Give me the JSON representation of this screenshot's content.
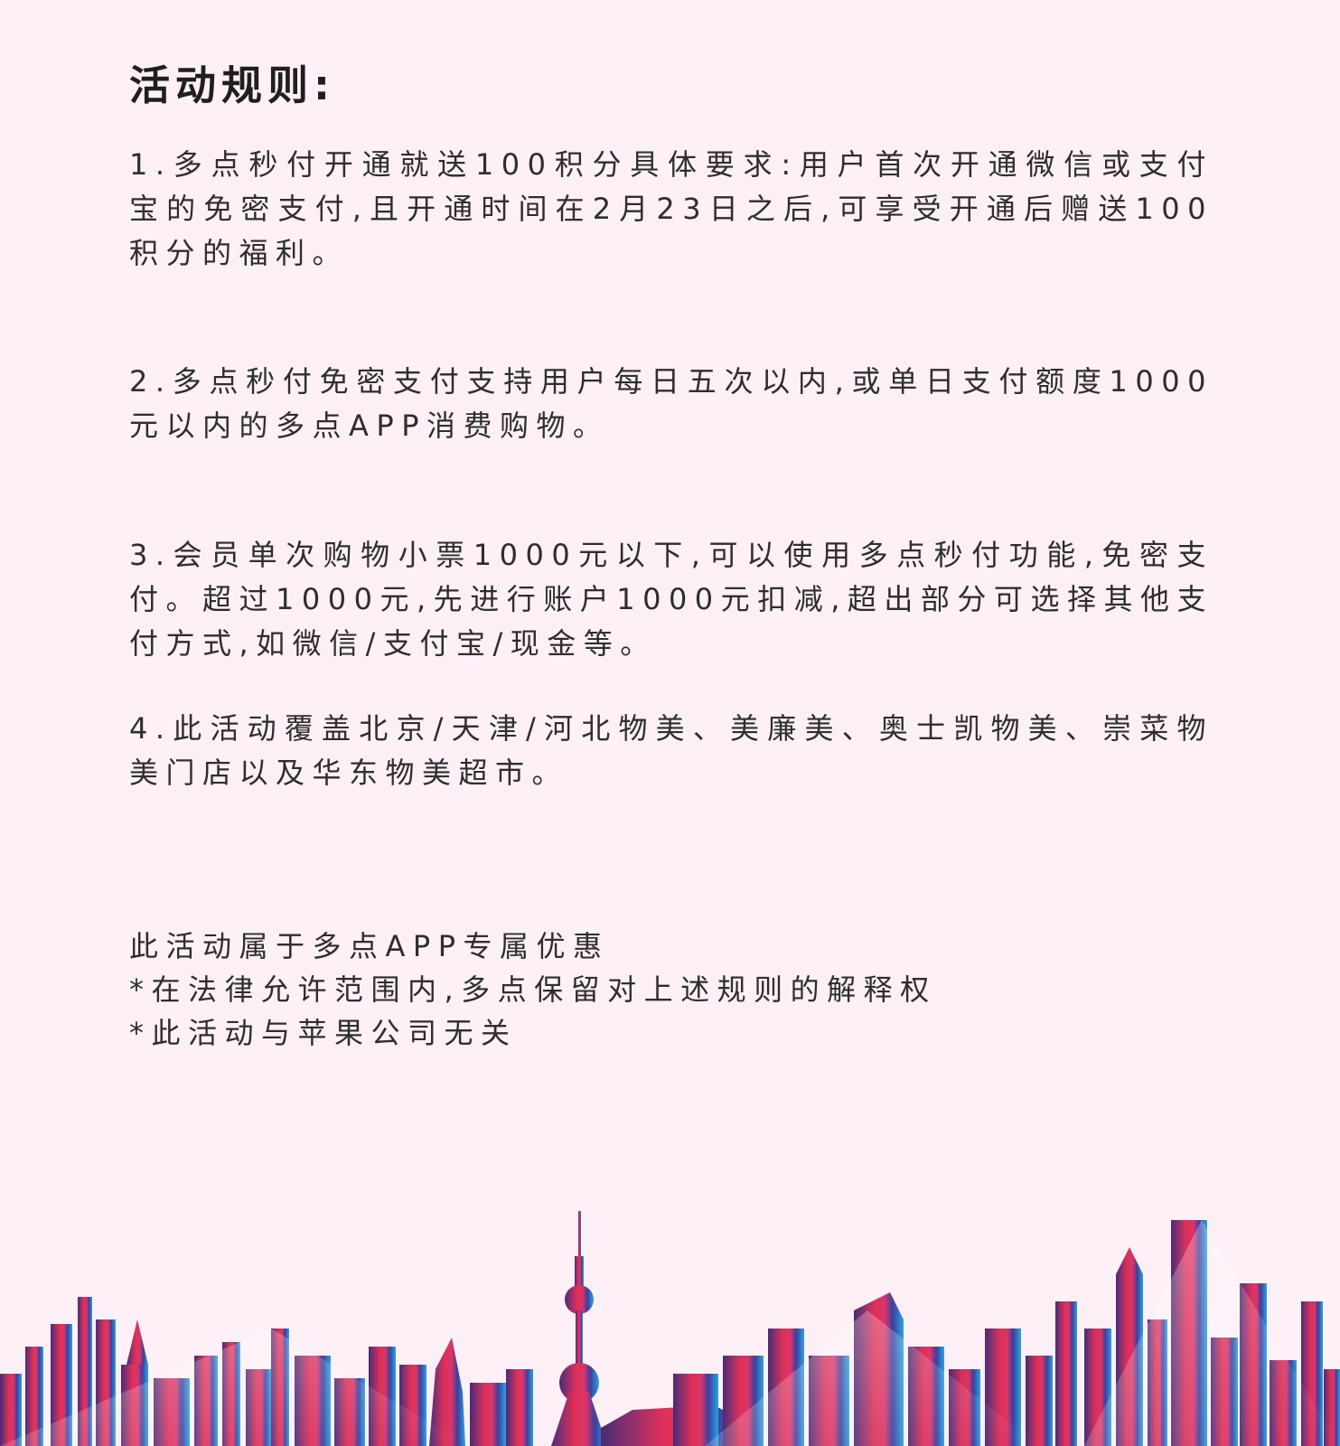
{
  "page": {
    "title": "活动规则:",
    "rules": [
      "1.多点秒付开通就送100积分具体要求:用户首次开通微信或支付宝的免密支付,且开通时间在2月23日之后,可享受开通后赠送100积分的福利。",
      "2.多点秒付免密支付支持用户每日五次以内,或单日支付额度1000元以内的多点APP消费购物。",
      "3.会员单次购物小票1000元以下,可以使用多点秒付功能,免密支付。超过1000元,先进行账户1000元扣减,超出部分可选择其他支付方式,如微信/支付宝/现金等。",
      "4.此活动覆盖北京/天津/河北物美、美廉美、奥士凯物美、崇菜物美门店以及华东物美超市。"
    ],
    "footer": {
      "exclusive": "此活动属于多点APP专属优惠",
      "legal_note": "*在法律允许范围内,多点保留对上述规则的解释权",
      "apple_note": "*此活动与苹果公司无关"
    }
  },
  "colors": {
    "background": "#fdf0f6",
    "text": "#2e2e2e",
    "skyline_left": "#5a2a78",
    "skyline_mid": "#e6305a",
    "skyline_right": "#2a8fd8"
  },
  "decoration": {
    "skyline_icon": "city-skyline-icon"
  }
}
